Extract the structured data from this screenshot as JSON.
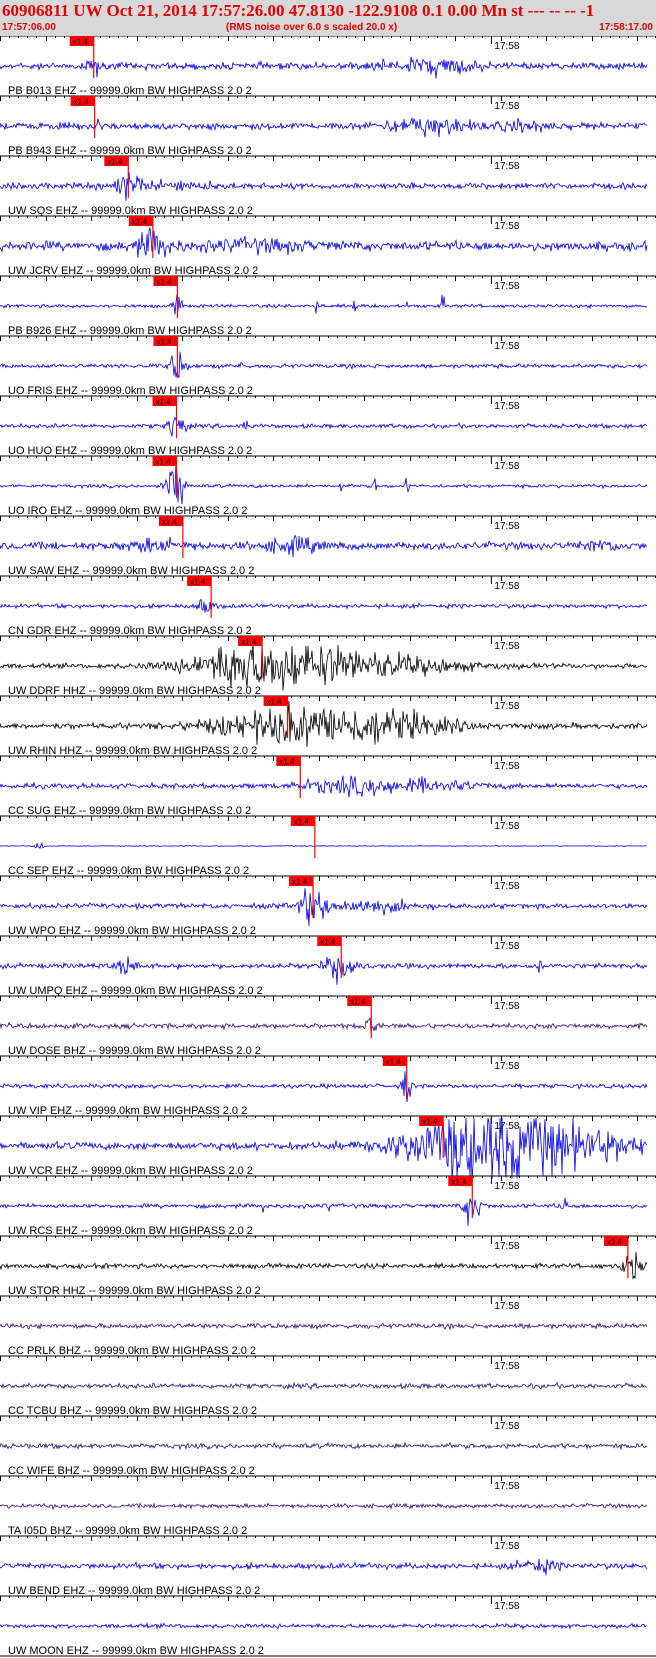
{
  "header": {
    "title": "60906811 UW Oct 21, 2014 17:57:26.00   47.8130 -122.9108  0.1 0.00 Mn st --- -- --  -1",
    "start_time": "17:57:06.00",
    "subtitle": "(RMS noise over 6.0 s scaled 20.0 x)",
    "end_time": "17:58:17.00"
  },
  "chart_data": {
    "type": "line",
    "time_range_s": [
      0,
      71
    ],
    "minute_marker": {
      "label": "17:58",
      "t": 54
    },
    "pick_label": "x1.4",
    "colors": {
      "blue": "#0000ee",
      "black": "#000000",
      "purple": "#3a1070",
      "pick": "#ff0000",
      "header_red": "#e00000"
    },
    "traces": [
      {
        "label": "PB B013 EHZ -- 99999.0km BW  HIGHPASS  2.0  2",
        "pick": 10.3,
        "color": "blue",
        "noise": 0.16
      },
      {
        "label": "PB B943 EHZ -- 99999.0km BW  HIGHPASS  2.0  2",
        "pick": 10.4,
        "color": "blue",
        "noise": 0.16
      },
      {
        "label": "UW SQS EHZ -- 99999.0km BW  HIGHPASS  2.0  2",
        "pick": 14.1,
        "color": "blue",
        "noise": 0.14
      },
      {
        "label": "UW JCRV EHZ -- 99999.0km BW  HIGHPASS  2.0  2",
        "pick": 16.8,
        "color": "blue",
        "noise": 0.22
      },
      {
        "label": "PB B926 EHZ -- 99999.0km BW  HIGHPASS  2.0  2",
        "pick": 19.5,
        "color": "blue",
        "noise": 0.08
      },
      {
        "label": "UO FRIS EHZ -- 99999.0km BW  HIGHPASS  2.0  2",
        "pick": 19.5,
        "color": "blue",
        "noise": 0.1
      },
      {
        "label": "UO HUO EHZ -- 99999.0km BW  HIGHPASS  2.0  2",
        "pick": 19.4,
        "color": "blue",
        "noise": 0.1
      },
      {
        "label": "UO IRO EHZ -- 99999.0km BW  HIGHPASS  2.0  2",
        "pick": 19.4,
        "color": "blue",
        "noise": 0.08
      },
      {
        "label": "UW SAW EHZ -- 99999.0km BW  HIGHPASS  2.0  2",
        "pick": 20.1,
        "color": "blue",
        "noise": 0.18
      },
      {
        "label": "CN GDR EHZ -- 99999.0km BW  HIGHPASS  2.0  2",
        "pick": 23.2,
        "color": "blue",
        "noise": 0.1
      },
      {
        "label": "UW DDRF HHZ -- 99999.0km BW  HIGHPASS  2.0  2",
        "pick": 28.8,
        "color": "black",
        "noise": 0.12
      },
      {
        "label": "UW RHIN HHZ -- 99999.0km BW  HIGHPASS  2.0  2",
        "pick": 31.6,
        "color": "black",
        "noise": 0.14
      },
      {
        "label": "CC SUG EHZ -- 99999.0km BW  HIGHPASS  2.0  2",
        "pick": 33.0,
        "color": "blue",
        "noise": 0.12
      },
      {
        "label": "CC SEP EHZ -- 99999.0km BW  HIGHPASS  2.0  2",
        "pick": 34.6,
        "color": "blue",
        "noise": 0.02
      },
      {
        "label": "UW WPO EHZ -- 99999.0km BW  HIGHPASS  2.0  2",
        "pick": 34.4,
        "color": "blue",
        "noise": 0.12
      },
      {
        "label": "UW UMPQ EHZ -- 99999.0km BW  HIGHPASS  2.0  2",
        "pick": 37.5,
        "color": "blue",
        "noise": 0.12
      },
      {
        "label": "UW DOSE BHZ -- 99999.0km BW  HIGHPASS  2.0  2",
        "pick": 40.8,
        "color": "purple",
        "noise": 0.12
      },
      {
        "label": "UW VIP EHZ -- 99999.0km BW  HIGHPASS  2.0  2",
        "pick": 44.7,
        "color": "blue",
        "noise": 0.1
      },
      {
        "label": "UW VCR EHZ -- 99999.0km BW  HIGHPASS  2.0  2",
        "pick": 48.7,
        "color": "blue",
        "noise": 0.18
      },
      {
        "label": "UW RCS EHZ -- 99999.0km BW  HIGHPASS  2.0  2",
        "pick": 51.9,
        "color": "blue",
        "noise": 0.1
      },
      {
        "label": "UW STOR HHZ -- 99999.0km BW  HIGHPASS  2.0  2",
        "pick": 69.0,
        "color": "black",
        "noise": 0.12
      },
      {
        "label": "CC PRLK BHZ -- 99999.0km BW  HIGHPASS  2.0  2",
        "pick": null,
        "color": "purple",
        "noise": 0.12
      },
      {
        "label": "CC TCBU BHZ -- 99999.0km BW  HIGHPASS  2.0  2",
        "pick": null,
        "color": "purple",
        "noise": 0.12
      },
      {
        "label": "CC WIFE BHZ -- 99999.0km BW  HIGHPASS  2.0  2",
        "pick": null,
        "color": "purple",
        "noise": 0.12
      },
      {
        "label": "TA I05D BHZ -- 99999.0km BW  HIGHPASS  2.0  2",
        "pick": null,
        "color": "purple",
        "noise": 0.1
      },
      {
        "label": "UW BEND EHZ -- 99999.0km BW  HIGHPASS  2.0  2",
        "pick": null,
        "color": "blue",
        "noise": 0.14
      },
      {
        "label": "UW MOON EHZ -- 99999.0km BW  HIGHPASS  2.0  2",
        "pick": null,
        "color": "blue",
        "noise": 0.1
      }
    ]
  }
}
